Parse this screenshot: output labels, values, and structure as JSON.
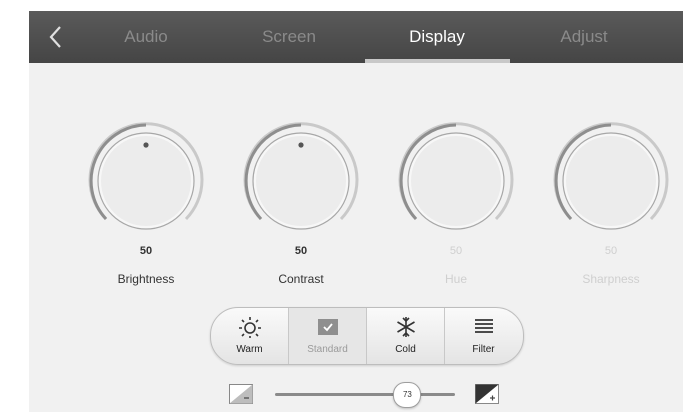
{
  "tabs": [
    {
      "label": "Audio",
      "active": false
    },
    {
      "label": "Screen",
      "active": false
    },
    {
      "label": "Display",
      "active": true
    },
    {
      "label": "Adjust",
      "active": false
    }
  ],
  "knobs": [
    {
      "value": "50",
      "label": "Brightness",
      "enabled": true
    },
    {
      "value": "50",
      "label": "Contrast",
      "enabled": true
    },
    {
      "value": "50",
      "label": "Hue",
      "enabled": false
    },
    {
      "value": "50",
      "label": "Sharpness",
      "enabled": false
    }
  ],
  "color_modes": [
    {
      "label": "Warm",
      "icon": "sun-icon",
      "selected": false
    },
    {
      "label": "Standard",
      "icon": "check-icon",
      "selected": true
    },
    {
      "label": "Cold",
      "icon": "snowflake-icon",
      "selected": false
    },
    {
      "label": "Filter",
      "icon": "filter-lines-icon",
      "selected": false
    }
  ],
  "slider": {
    "value": "73",
    "fraction": 0.73
  },
  "colors": {
    "topbar": "#4a4a4a",
    "panel": "#f1f1f1",
    "tab_active": "#ffffff",
    "tab_inactive": "#8a8a8a"
  }
}
